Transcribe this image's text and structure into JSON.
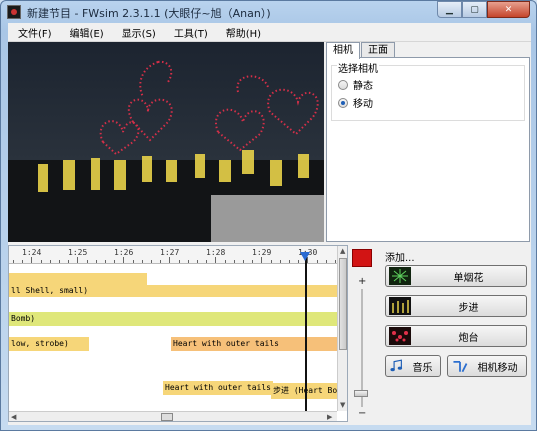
{
  "window": {
    "title": "新建节目 - FWsim 2.3.1.1 (大眼仔~旭（Anan）)"
  },
  "menu": [
    "文件(F)",
    "编辑(E)",
    "显示(S)",
    "工具(T)",
    "帮助(H)"
  ],
  "tabs": [
    {
      "label": "相机"
    },
    {
      "label": "正面"
    }
  ],
  "camera_group": {
    "title": "选择相机",
    "options": [
      "静态",
      "移动"
    ],
    "selected": "移动"
  },
  "ruler": {
    "labels": [
      "1:24",
      "1:25",
      "1:26",
      "1:27",
      "1:28",
      "1:29",
      "1:30"
    ]
  },
  "tracks": [
    {
      "text": "",
      "color": "#f6d679"
    },
    {
      "text": "ll Shell, small)",
      "color": "#f6d679"
    },
    {
      "text": "Bomb)",
      "color": "#dfe77a"
    },
    {
      "text": "low, strobe)",
      "color": "#f6d679"
    },
    {
      "text": "Heart with outer tails",
      "color": "#f6c079"
    },
    {
      "text": "Heart with outer tails",
      "color": "#f6d679"
    },
    {
      "text": "步进 (Heart Bo",
      "color": "#f6d679"
    }
  ],
  "add_panel": {
    "label": "添加...",
    "buttons": {
      "single": "单烟花",
      "step": "步进",
      "battery": "炮台",
      "music": "音乐",
      "camera_move": "相机移动"
    }
  },
  "zoom": {
    "plus": "+",
    "minus": "−"
  },
  "colors": {
    "accent": "#d21414",
    "playhead": "#2a6bd3"
  }
}
